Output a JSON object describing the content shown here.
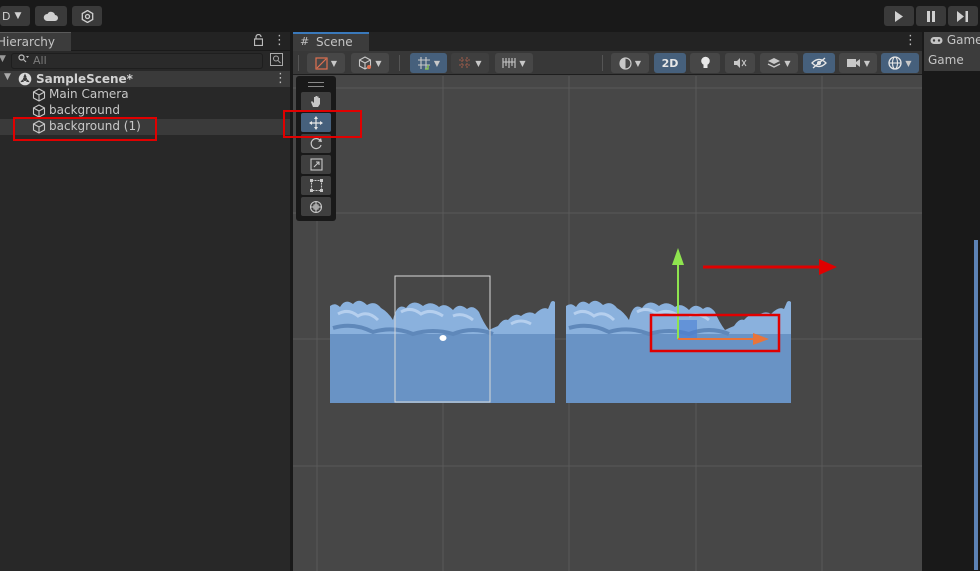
{
  "toolbar": {
    "account_label": "D",
    "cloud_icon": "cloud-icon",
    "services_icon": "gear-icon",
    "play_icon": "play-icon",
    "pause_icon": "pause-icon",
    "step_icon": "step-icon"
  },
  "hierarchy": {
    "tab_label": "Hierarchy",
    "search_placeholder": "All",
    "scene_name": "SampleScene*",
    "items": [
      {
        "label": "Main Camera"
      },
      {
        "label": "background"
      },
      {
        "label": "background (1)"
      }
    ],
    "selected_item": "background (1)"
  },
  "scene": {
    "tab_label": "Scene",
    "toolbar": {
      "mode_2d_label": "2D",
      "buttons": [
        "draw-mode",
        "shading",
        "transform-pivot",
        "grid",
        "snap",
        "2d-toggle",
        "lighting",
        "audio",
        "effects",
        "hidden-objects",
        "camera",
        "gizmos"
      ]
    },
    "tools": [
      "hand-tool",
      "move-tool",
      "rotate-tool",
      "scale-tool",
      "rect-tool",
      "transform-tool"
    ],
    "active_tool": "move-tool",
    "annotation_color": "#e00000",
    "sky_color": "#7097c6",
    "accent_active": "#46607c"
  },
  "game": {
    "tab_label": "Game",
    "view_label": "Game"
  }
}
